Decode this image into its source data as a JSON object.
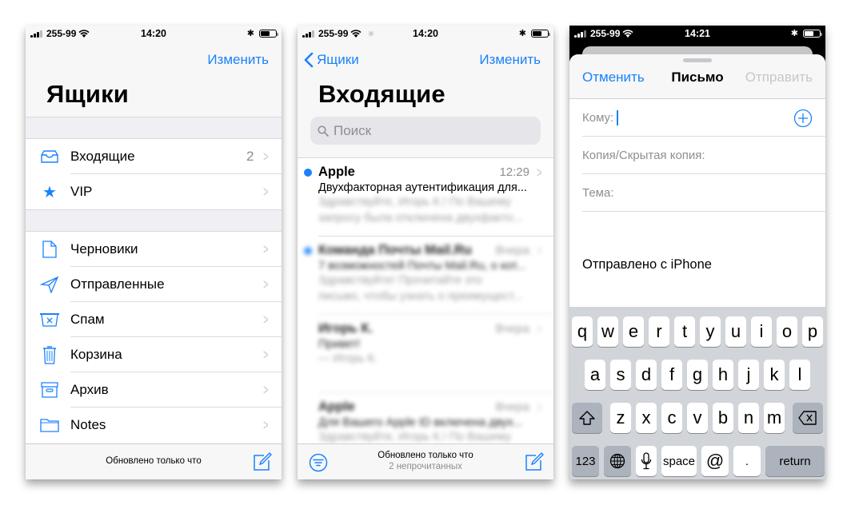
{
  "screens": [
    {
      "status": {
        "carrier": "255-99",
        "time": "14:20"
      },
      "nav": {
        "edit": "Изменить"
      },
      "title": "Ящики",
      "groups": [
        [
          {
            "icon": "inbox-icon",
            "label": "Входящие",
            "badge": "2"
          },
          {
            "icon": "star-icon",
            "label": "VIP",
            "badge": ""
          }
        ],
        [
          {
            "icon": "draft-icon",
            "label": "Черновики",
            "badge": ""
          },
          {
            "icon": "sent-icon",
            "label": "Отправленные",
            "badge": ""
          },
          {
            "icon": "spam-icon",
            "label": "Спам",
            "badge": ""
          },
          {
            "icon": "trash-icon",
            "label": "Корзина",
            "badge": ""
          },
          {
            "icon": "archive-icon",
            "label": "Архив",
            "badge": ""
          },
          {
            "icon": "folder-icon",
            "label": "Notes",
            "badge": ""
          }
        ]
      ],
      "toolbar": {
        "status": "Обновлено только что"
      }
    },
    {
      "status": {
        "carrier": "255-99",
        "time": "14:20"
      },
      "nav": {
        "back": "Ящики",
        "edit": "Изменить"
      },
      "title": "Входящие",
      "search": {
        "placeholder": "Поиск"
      },
      "messages": [
        {
          "from": "Apple",
          "time": "12:29",
          "unread": true,
          "subject": "Двухфакторная аутентификация для...",
          "preview": [
            "Здравствуйте, Игорь К.! По Вашему",
            "запросу была отключена двухфакто..."
          ]
        },
        {
          "from": "Команда Почты Mail.Ru",
          "time": "Вчера",
          "unread": true,
          "subject": "7 возможностей Почты Mail.Ru, о кот...",
          "preview": [
            "Здравствуйте! Прочитайте это",
            "письмо, чтобы узнать о преимущест..."
          ]
        },
        {
          "from": "Игорь К.",
          "time": "Вчера",
          "unread": false,
          "subject": "Привет!",
          "preview": [
            "— Игорь К.",
            ""
          ]
        },
        {
          "from": "Apple",
          "time": "Вчера",
          "unread": false,
          "subject": "Для Вашего Apple ID включена двух...",
          "preview": [
            "Здравствуйте, Игорь К.! По Вашему",
            ""
          ]
        }
      ],
      "toolbar": {
        "status": "Обновлено только что",
        "unread": "2 непрочитанных"
      }
    },
    {
      "status": {
        "carrier": "255-99",
        "time": "14:21"
      },
      "header": {
        "cancel": "Отменить",
        "title": "Письмо",
        "send": "Отправить"
      },
      "fields": {
        "to": "Кому:",
        "cc": "Копия/Скрытая копия:",
        "subject": "Тема:"
      },
      "signature": "Отправлено с iPhone",
      "keyboard": {
        "row1": [
          "q",
          "w",
          "e",
          "r",
          "t",
          "y",
          "u",
          "i",
          "o",
          "p"
        ],
        "row2": [
          "a",
          "s",
          "d",
          "f",
          "g",
          "h",
          "j",
          "k",
          "l"
        ],
        "row3": [
          "z",
          "x",
          "c",
          "v",
          "b",
          "n",
          "m"
        ],
        "numbers": "123",
        "space": "space",
        "at": "@",
        "dot": ".",
        "return": "return"
      }
    }
  ],
  "colors": {
    "accent": "#1a82fb",
    "unread_dot": "#1a82fb",
    "disabled": "#c7c7cc",
    "keyboard_bg": "#d1d4d9",
    "fn_key": "#acb3bc"
  }
}
